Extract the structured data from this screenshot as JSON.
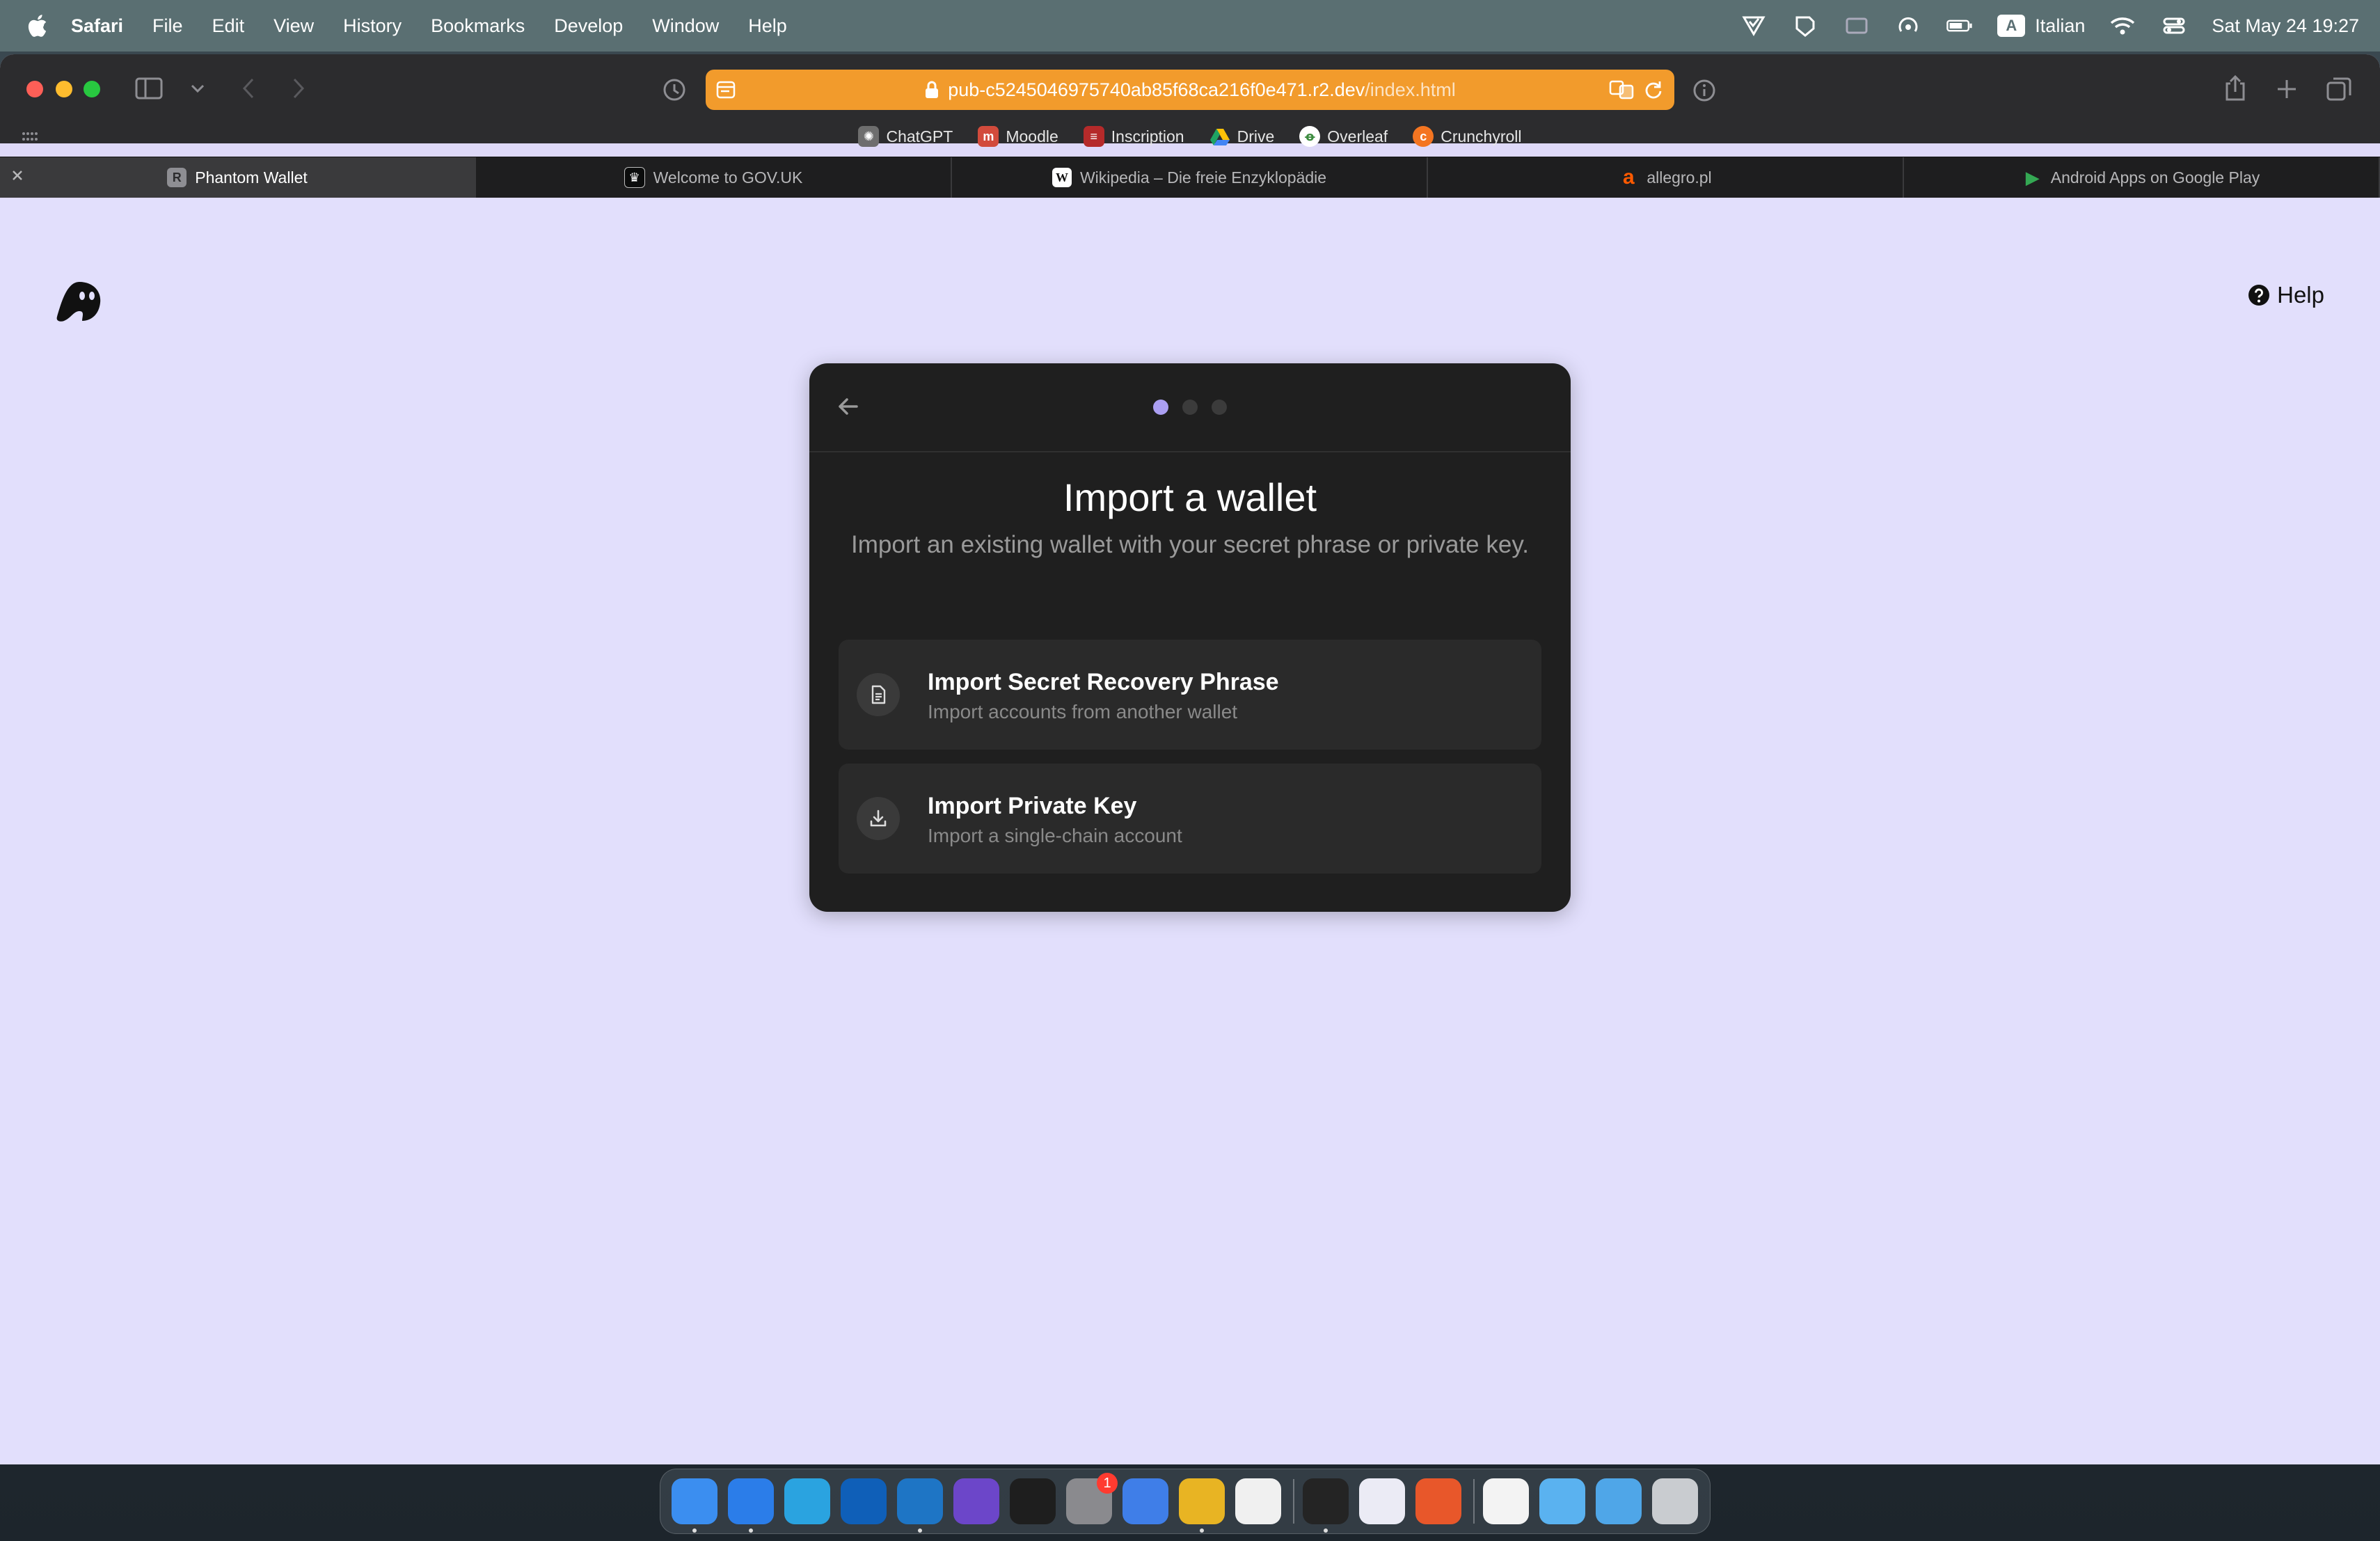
{
  "menubar": {
    "app_name": "Safari",
    "items": [
      "File",
      "Edit",
      "View",
      "History",
      "Bookmarks",
      "Develop",
      "Window",
      "Help"
    ],
    "input_badge": "A",
    "input_language": "Italian",
    "datetime": "Sat May 24  19:27"
  },
  "browser": {
    "url_host": "pub-c5245046975740ab85f68ca216f0e471.r2.dev",
    "url_path": "/index.html",
    "favorites": [
      {
        "label": "ChatGPT",
        "icon": "chatgpt-icon",
        "color": "#6e6e6e"
      },
      {
        "label": "Moodle",
        "icon": "moodle-icon",
        "color": "#d24b3c"
      },
      {
        "label": "Inscription",
        "icon": "inscription-icon",
        "color": "#b52a2a"
      },
      {
        "label": "Drive",
        "icon": "drive-icon",
        "color": "#1fa463"
      },
      {
        "label": "Overleaf",
        "icon": "overleaf-icon",
        "color": "#3d8c40"
      },
      {
        "label": "Crunchyroll",
        "icon": "crunchyroll-icon",
        "color": "#f47521"
      }
    ],
    "tabs": [
      {
        "label": "Phantom Wallet",
        "icon_letter": "R",
        "active": true
      },
      {
        "label": "Welcome to GOV.UK",
        "icon_letter": "♛"
      },
      {
        "label": "Wikipedia – Die freie Enzyklopädie",
        "icon_letter": "W"
      },
      {
        "label": "allegro.pl",
        "icon_letter": "a"
      },
      {
        "label": "Android Apps on Google Play",
        "icon_letter": "▶"
      }
    ]
  },
  "page": {
    "help_label": "Help",
    "title": "Import a wallet",
    "subtitle": "Import an existing wallet with your secret phrase or private key.",
    "step_total": 3,
    "step_current": 1,
    "options": [
      {
        "title": "Import Secret Recovery Phrase",
        "description": "Import accounts from another wallet",
        "icon": "document-icon"
      },
      {
        "title": "Import Private Key",
        "description": "Import a single-chain account",
        "icon": "download-icon"
      }
    ]
  },
  "colors": {
    "page_bg": "#e2dffc",
    "card_bg": "#1f1f1f",
    "accent": "#ab9ff2",
    "url_bar": "#f29b2c"
  },
  "dock": {
    "apps": [
      {
        "name": "finder-icon",
        "color": "#3b8ef0"
      },
      {
        "name": "safari-icon",
        "color": "#2b7de9"
      },
      {
        "name": "telegram-icon",
        "color": "#2aa3e0"
      },
      {
        "name": "outlook-icon",
        "color": "#0f5fb8"
      },
      {
        "name": "vscode-icon",
        "color": "#1e75c5"
      },
      {
        "name": "obsidian-icon",
        "color": "#6c46c9"
      },
      {
        "name": "figma-icon",
        "color": "#1e1e1e"
      },
      {
        "name": "system-settings-icon",
        "color": "#8a8a8e"
      },
      {
        "name": "google-docs-icon",
        "color": "#3f7ee8"
      },
      {
        "name": "chrome-icon",
        "color": "#e8b423"
      },
      {
        "name": "moodle-icon",
        "color": "#f0f0f0"
      },
      {
        "name": "activity-monitor-icon",
        "color": "#242424"
      },
      {
        "name": "proton-vpn-icon",
        "color": "#ebebf5"
      },
      {
        "name": "firefox-icon",
        "color": "#e8572a"
      },
      {
        "name": "document-stack-icon",
        "color": "#f3f3f3"
      },
      {
        "name": "folder-icon",
        "color": "#5ab2f0"
      },
      {
        "name": "downloads-folder-icon",
        "color": "#4fa6e8"
      },
      {
        "name": "trash-icon",
        "color": "#c9ccd0"
      }
    ],
    "settings_badge": "1"
  }
}
